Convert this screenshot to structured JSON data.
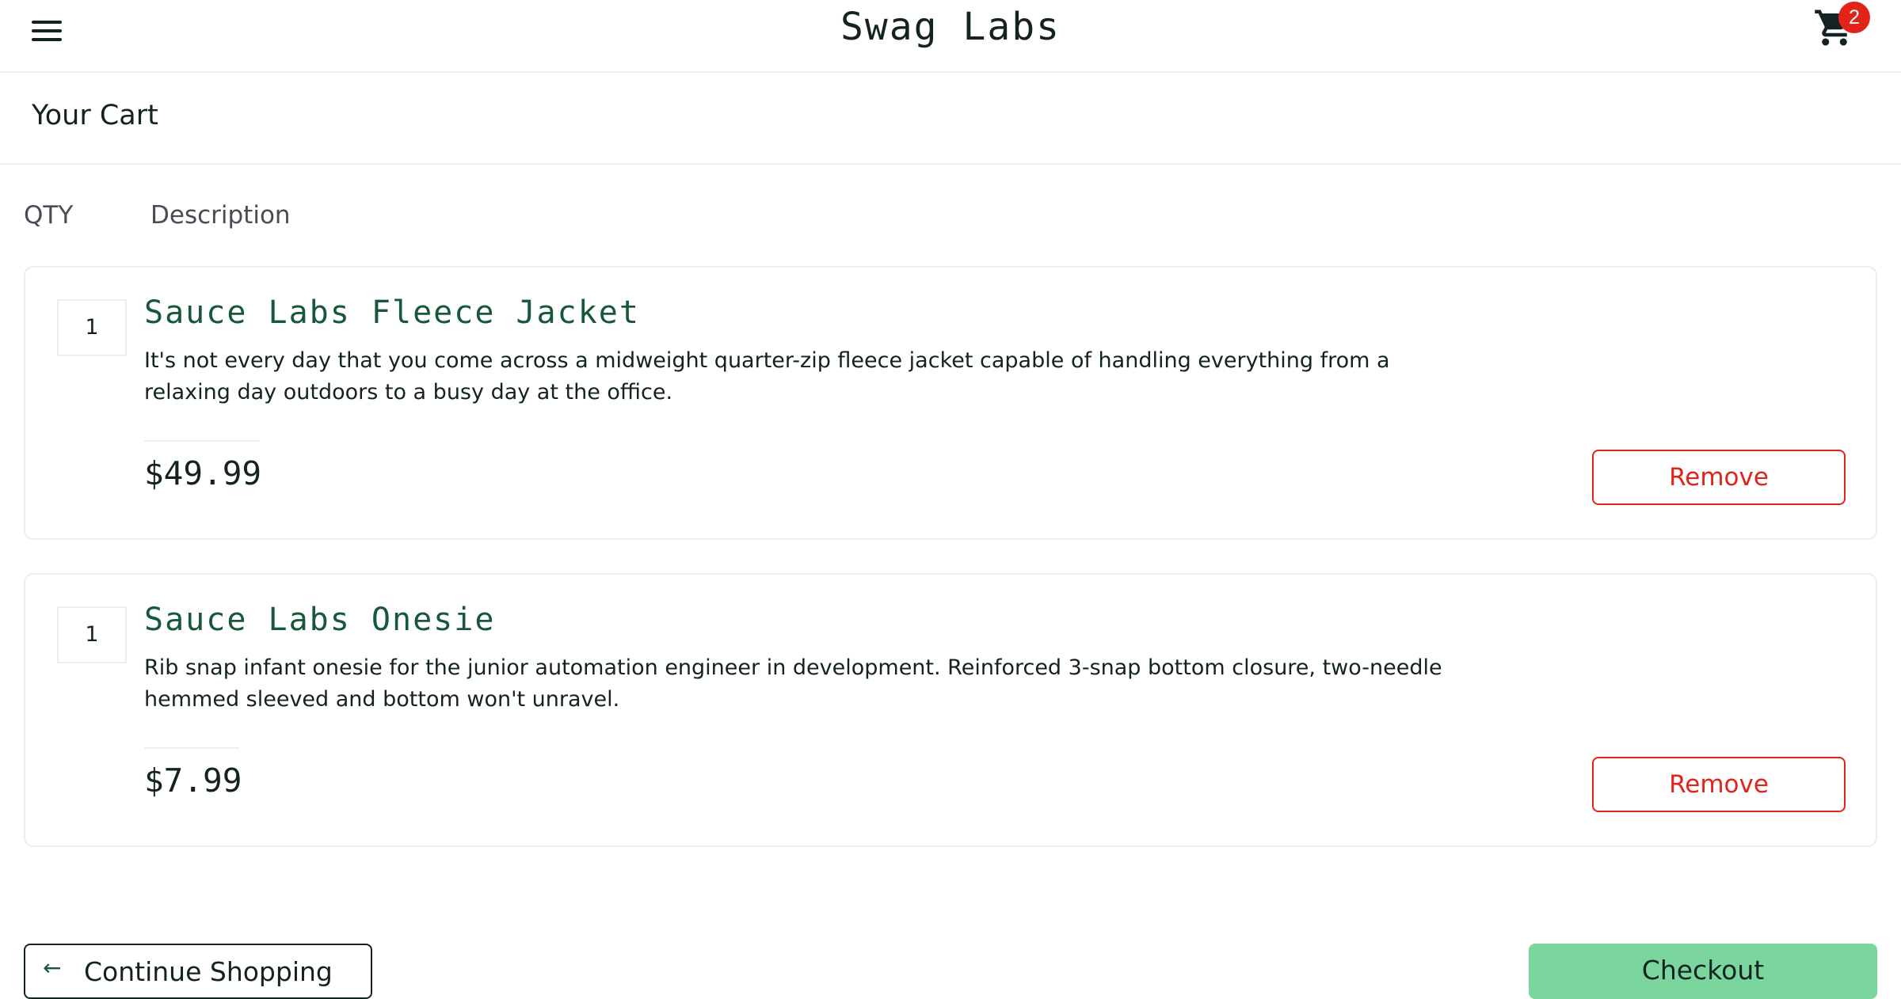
{
  "header": {
    "app_title": "Swag Labs",
    "menu_icon": "hamburger-menu-icon",
    "cart_icon": "shopping-cart-icon",
    "cart_count": "2",
    "badge_color": "#e2231a"
  },
  "page": {
    "title": "Your Cart"
  },
  "columns": {
    "qty": "QTY",
    "description": "Description"
  },
  "items": [
    {
      "qty": "1",
      "name": "Sauce Labs Fleece Jacket",
      "description": "It's not every day that you come across a midweight quarter-zip fleece jacket capable of handling everything from a relaxing day outdoors to a busy day at the office.",
      "price": "$49.99",
      "remove_label": "Remove"
    },
    {
      "qty": "1",
      "name": "Sauce Labs Onesie",
      "description": "Rib snap infant onesie for the junior automation engineer in development. Reinforced 3-snap bottom closure, two-needle hemmed sleeved and bottom won't unravel.",
      "price": "$7.99",
      "remove_label": "Remove"
    }
  ],
  "footer": {
    "continue_label": "Continue Shopping",
    "continue_icon": "arrow-left-icon",
    "checkout_label": "Checkout",
    "checkout_color": "#7ad69c"
  }
}
